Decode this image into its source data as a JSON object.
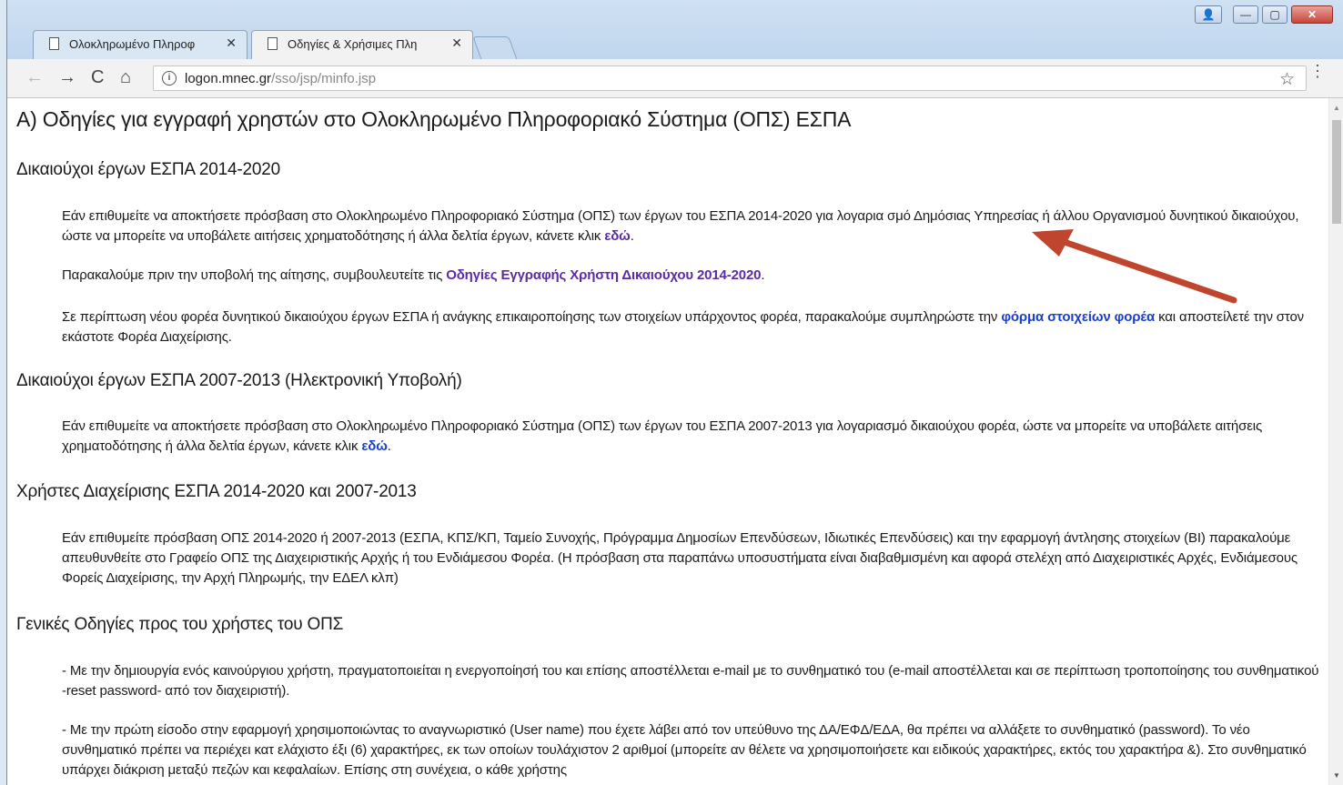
{
  "tabs": [
    {
      "label": "Ολοκληρωμένο Πληροφ",
      "close": "✕"
    },
    {
      "label": "Οδηγίες & Χρήσιμες Πλη",
      "close": "✕"
    }
  ],
  "window_controls": {
    "user": "👤",
    "minimize": "—",
    "maximize": "▢",
    "close": "✕"
  },
  "toolbar": {
    "back": "←",
    "forward": "→",
    "reload": "C",
    "home": "⌂",
    "info": "i",
    "url_host": "logon.mnec.gr",
    "url_path": "/sso/jsp/minfo.jsp",
    "star": "☆",
    "menu": "⋮"
  },
  "page": {
    "h1": "Α) Οδηγίες για εγγραφή χρηστών στο Ολοκληρωμένο Πληροφοριακό Σύστημα (ΟΠΣ) ΕΣΠΑ",
    "sec1": {
      "title": "Δικαιούχοι έργων ΕΣΠΑ 2014-2020",
      "p1_text": "Εάν επιθυμείτε να αποκτήσετε πρόσβαση στο Ολοκληρωμένο Πληροφοριακό Σύστημα (ΟΠΣ) των έργων του ΕΣΠΑ 2014-2020 για λογαρια σμό Δημόσιας Υπηρεσίας ή άλλου Οργανισμού δυνητικού δικαιούχου, ώστε να μπορείτε να υποβάλετε αιτήσεις χρηματοδότησης ή άλλα δελτία έργων, κάνετε κλικ ",
      "p1_link": "εδώ",
      "p1_end": ".",
      "p2_text": "Παρακαλούμε πριν την υποβολή της αίτησης, συμβουλευτείτε τις ",
      "p2_link": "Οδηγίες Εγγραφής Χρήστη Δικαιούχου 2014-2020",
      "p2_end": ".",
      "p3_text": "Σε περίπτωση νέου φορέα δυνητικού δικαιούχου έργων ΕΣΠΑ ή ανάγκης επικαιροποίησης των στοιχείων υπάρχοντος φορέα, παρακαλούμε συμπληρώστε την ",
      "p3_link": "φόρμα στοιχείων φορέα",
      "p3_end": " και αποστείλετέ την στον εκάστοτε Φορέα Διαχείρισης."
    },
    "sec2": {
      "title": "Δικαιούχοι έργων ΕΣΠΑ 2007-2013 (Ηλεκτρονική Υποβολή)",
      "p1_text": "Εάν επιθυμείτε να αποκτήσετε πρόσβαση στο Ολοκληρωμένο Πληροφοριακό Σύστημα (ΟΠΣ) των έργων του ΕΣΠΑ 2007-2013 για λογαριασμό δικαιούχου φορέα, ώστε να μπορείτε να υποβάλετε αιτήσεις χρηματοδότησης ή άλλα δελτία έργων, κάνετε κλικ ",
      "p1_link": "εδώ",
      "p1_end": "."
    },
    "sec3": {
      "title": "Χρήστες Διαχείρισης ΕΣΠΑ 2014-2020 και 2007-2013",
      "p1_text": "Εάν επιθυμείτε πρόσβαση ΟΠΣ 2014-2020 ή 2007-2013 (ΕΣΠΑ, ΚΠΣ/ΚΠ, Ταμείο Συνοχής, Πρόγραμμα Δημοσίων Επενδύσεων, Ιδιωτικές Επενδύσεις) και την εφαρμογή άντλησης στοιχείων (BI) παρακαλούμε απευθυνθείτε στο Γραφείο ΟΠΣ της Διαχειριστικής Αρχής ή του Ενδιάμεσου Φορέα. (Η πρόσβαση στα παραπάνω υποσυστήματα είναι διαβαθμισμένη και αφορά στελέχη από Διαχειριστικές Αρχές, Ενδιάμεσους Φορείς Διαχείρισης, την Αρχή Πληρωμής, την ΕΔΕΛ κλπ)"
    },
    "sec4": {
      "title": "Γενικές Οδηγίες προς του χρήστες του ΟΠΣ",
      "p1_text": "- Με την δημιουργία ενός καινούργιου χρήστη, πραγματοποιείται η ενεργοποίησή του και επίσης αποστέλλεται e-mail με το συνθηματικό του (e-mail αποστέλλεται και σε περίπτωση τροποποίησης του συνθηματικού -reset password- από τον διαχειριστή).",
      "p2_text": "- Με την πρώτη είσοδο στην εφαρμογή χρησιμοποιώντας το αναγνωριστικό (User name) που έχετε λάβει από τον υπεύθυνο της ΔΑ/ΕΦΔ/ΕΔΑ, θα πρέπει να αλλάξετε το συνθηματικό (password). Το νέο συνθηματικό πρέπει να περιέχει κατ ελάχιστο έξι (6) χαρακτήρες, εκ των οποίων τουλάχιστον 2 αριθμοί (μπορείτε αν θέλετε να χρησιμοποιήσετε και ειδικούς χαρακτήρες, εκτός του χαρακτήρα &). Στο συνθηματικό υπάρχει διάκριση μεταξύ πεζών και κεφαλαίων. Επίσης στη συνέχεια, ο κάθε χρήστης"
    }
  },
  "colors": {
    "arrow": "#c0452e",
    "link_visited": "#5b2aa8",
    "link": "#1a3fd0"
  }
}
